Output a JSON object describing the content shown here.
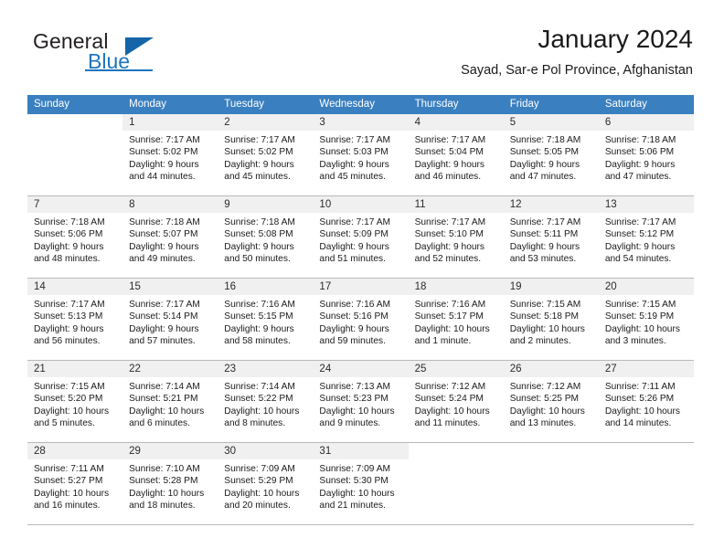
{
  "brand": {
    "name_primary": "General",
    "name_secondary": "Blue",
    "accent_color": "#1d74bd",
    "triangle_color": "#1565a8"
  },
  "header": {
    "title": "January 2024",
    "subtitle": "Sayad, Sar-e Pol Province, Afghanistan"
  },
  "calendar": {
    "header_bg": "#3a7fbf",
    "daynum_bg": "#f0f0f0",
    "weekdays": [
      "Sunday",
      "Monday",
      "Tuesday",
      "Wednesday",
      "Thursday",
      "Friday",
      "Saturday"
    ],
    "weeks": [
      [
        {
          "day": "",
          "lines": []
        },
        {
          "day": "1",
          "lines": [
            "Sunrise: 7:17 AM",
            "Sunset: 5:02 PM",
            "Daylight: 9 hours",
            "and 44 minutes."
          ]
        },
        {
          "day": "2",
          "lines": [
            "Sunrise: 7:17 AM",
            "Sunset: 5:02 PM",
            "Daylight: 9 hours",
            "and 45 minutes."
          ]
        },
        {
          "day": "3",
          "lines": [
            "Sunrise: 7:17 AM",
            "Sunset: 5:03 PM",
            "Daylight: 9 hours",
            "and 45 minutes."
          ]
        },
        {
          "day": "4",
          "lines": [
            "Sunrise: 7:17 AM",
            "Sunset: 5:04 PM",
            "Daylight: 9 hours",
            "and 46 minutes."
          ]
        },
        {
          "day": "5",
          "lines": [
            "Sunrise: 7:18 AM",
            "Sunset: 5:05 PM",
            "Daylight: 9 hours",
            "and 47 minutes."
          ]
        },
        {
          "day": "6",
          "lines": [
            "Sunrise: 7:18 AM",
            "Sunset: 5:06 PM",
            "Daylight: 9 hours",
            "and 47 minutes."
          ]
        }
      ],
      [
        {
          "day": "7",
          "lines": [
            "Sunrise: 7:18 AM",
            "Sunset: 5:06 PM",
            "Daylight: 9 hours",
            "and 48 minutes."
          ]
        },
        {
          "day": "8",
          "lines": [
            "Sunrise: 7:18 AM",
            "Sunset: 5:07 PM",
            "Daylight: 9 hours",
            "and 49 minutes."
          ]
        },
        {
          "day": "9",
          "lines": [
            "Sunrise: 7:18 AM",
            "Sunset: 5:08 PM",
            "Daylight: 9 hours",
            "and 50 minutes."
          ]
        },
        {
          "day": "10",
          "lines": [
            "Sunrise: 7:17 AM",
            "Sunset: 5:09 PM",
            "Daylight: 9 hours",
            "and 51 minutes."
          ]
        },
        {
          "day": "11",
          "lines": [
            "Sunrise: 7:17 AM",
            "Sunset: 5:10 PM",
            "Daylight: 9 hours",
            "and 52 minutes."
          ]
        },
        {
          "day": "12",
          "lines": [
            "Sunrise: 7:17 AM",
            "Sunset: 5:11 PM",
            "Daylight: 9 hours",
            "and 53 minutes."
          ]
        },
        {
          "day": "13",
          "lines": [
            "Sunrise: 7:17 AM",
            "Sunset: 5:12 PM",
            "Daylight: 9 hours",
            "and 54 minutes."
          ]
        }
      ],
      [
        {
          "day": "14",
          "lines": [
            "Sunrise: 7:17 AM",
            "Sunset: 5:13 PM",
            "Daylight: 9 hours",
            "and 56 minutes."
          ]
        },
        {
          "day": "15",
          "lines": [
            "Sunrise: 7:17 AM",
            "Sunset: 5:14 PM",
            "Daylight: 9 hours",
            "and 57 minutes."
          ]
        },
        {
          "day": "16",
          "lines": [
            "Sunrise: 7:16 AM",
            "Sunset: 5:15 PM",
            "Daylight: 9 hours",
            "and 58 minutes."
          ]
        },
        {
          "day": "17",
          "lines": [
            "Sunrise: 7:16 AM",
            "Sunset: 5:16 PM",
            "Daylight: 9 hours",
            "and 59 minutes."
          ]
        },
        {
          "day": "18",
          "lines": [
            "Sunrise: 7:16 AM",
            "Sunset: 5:17 PM",
            "Daylight: 10 hours",
            "and 1 minute."
          ]
        },
        {
          "day": "19",
          "lines": [
            "Sunrise: 7:15 AM",
            "Sunset: 5:18 PM",
            "Daylight: 10 hours",
            "and 2 minutes."
          ]
        },
        {
          "day": "20",
          "lines": [
            "Sunrise: 7:15 AM",
            "Sunset: 5:19 PM",
            "Daylight: 10 hours",
            "and 3 minutes."
          ]
        }
      ],
      [
        {
          "day": "21",
          "lines": [
            "Sunrise: 7:15 AM",
            "Sunset: 5:20 PM",
            "Daylight: 10 hours",
            "and 5 minutes."
          ]
        },
        {
          "day": "22",
          "lines": [
            "Sunrise: 7:14 AM",
            "Sunset: 5:21 PM",
            "Daylight: 10 hours",
            "and 6 minutes."
          ]
        },
        {
          "day": "23",
          "lines": [
            "Sunrise: 7:14 AM",
            "Sunset: 5:22 PM",
            "Daylight: 10 hours",
            "and 8 minutes."
          ]
        },
        {
          "day": "24",
          "lines": [
            "Sunrise: 7:13 AM",
            "Sunset: 5:23 PM",
            "Daylight: 10 hours",
            "and 9 minutes."
          ]
        },
        {
          "day": "25",
          "lines": [
            "Sunrise: 7:12 AM",
            "Sunset: 5:24 PM",
            "Daylight: 10 hours",
            "and 11 minutes."
          ]
        },
        {
          "day": "26",
          "lines": [
            "Sunrise: 7:12 AM",
            "Sunset: 5:25 PM",
            "Daylight: 10 hours",
            "and 13 minutes."
          ]
        },
        {
          "day": "27",
          "lines": [
            "Sunrise: 7:11 AM",
            "Sunset: 5:26 PM",
            "Daylight: 10 hours",
            "and 14 minutes."
          ]
        }
      ],
      [
        {
          "day": "28",
          "lines": [
            "Sunrise: 7:11 AM",
            "Sunset: 5:27 PM",
            "Daylight: 10 hours",
            "and 16 minutes."
          ]
        },
        {
          "day": "29",
          "lines": [
            "Sunrise: 7:10 AM",
            "Sunset: 5:28 PM",
            "Daylight: 10 hours",
            "and 18 minutes."
          ]
        },
        {
          "day": "30",
          "lines": [
            "Sunrise: 7:09 AM",
            "Sunset: 5:29 PM",
            "Daylight: 10 hours",
            "and 20 minutes."
          ]
        },
        {
          "day": "31",
          "lines": [
            "Sunrise: 7:09 AM",
            "Sunset: 5:30 PM",
            "Daylight: 10 hours",
            "and 21 minutes."
          ]
        },
        {
          "day": "",
          "lines": []
        },
        {
          "day": "",
          "lines": []
        },
        {
          "day": "",
          "lines": []
        }
      ]
    ]
  }
}
